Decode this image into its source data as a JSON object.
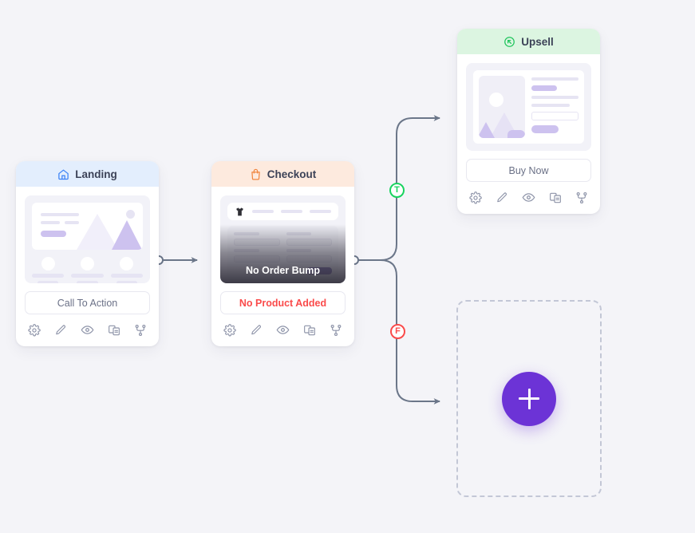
{
  "canvas": {
    "background": "#f4f4f8",
    "accent": "#6c33d6"
  },
  "steps": [
    {
      "id": "landing",
      "title": "Landing",
      "icon": "home-icon",
      "icon_color": "#3b82f6",
      "header_color": "#e3eefd",
      "cta_label": "Call To Action",
      "cta_state": "normal",
      "actions": [
        "gear-icon",
        "pencil-icon",
        "eye-icon",
        "split-test-icon",
        "branch-icon"
      ]
    },
    {
      "id": "checkout",
      "title": "Checkout",
      "icon": "shopping-bag-icon",
      "icon_color": "#f08741",
      "header_color": "#fdeade",
      "overlay_label": "No Order Bump",
      "cta_label": "No Product Added",
      "cta_state": "danger",
      "cta_color": "#fa4b4b",
      "actions": [
        "gear-icon",
        "pencil-icon",
        "eye-icon",
        "split-test-icon",
        "branch-icon"
      ]
    },
    {
      "id": "upsell",
      "title": "Upsell",
      "icon": "upsell-arrow-icon",
      "icon_color": "#22c55e",
      "header_color": "#dcf5e1",
      "cta_label": "Buy Now",
      "cta_state": "normal",
      "actions": [
        "gear-icon",
        "pencil-icon",
        "eye-icon",
        "split-test-icon",
        "branch-icon"
      ]
    }
  ],
  "branches": [
    {
      "id": "true-branch",
      "label": "T",
      "color": "#18d35f",
      "target": "upsell"
    },
    {
      "id": "false-branch",
      "label": "F",
      "color": "#fa4a4a",
      "target": "empty-slot"
    }
  ],
  "empty_slot": {
    "add_button_icon": "plus-icon",
    "add_button_color": "#6c33d6"
  }
}
